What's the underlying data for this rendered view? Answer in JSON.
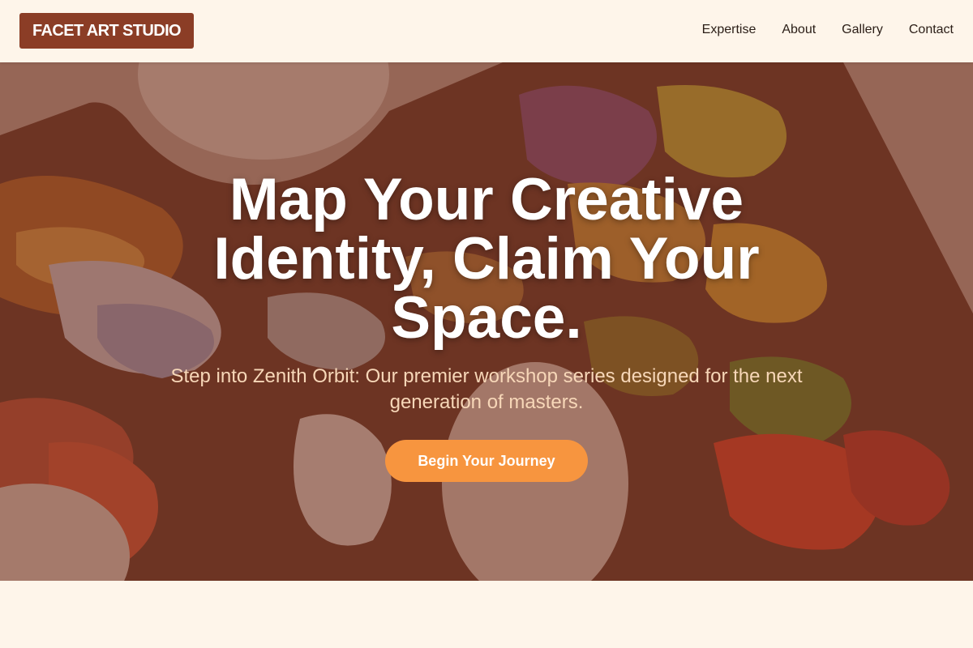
{
  "header": {
    "logo": "FACET ART STUDIO",
    "nav": [
      "Expertise",
      "About",
      "Gallery",
      "Contact"
    ]
  },
  "hero": {
    "title": "Map Your Creative Identity, Claim Your Space.",
    "subtitle": "Step into Zenith Orbit: Our premier workshop series designed for the next generation of masters.",
    "cta_label": "Begin Your Journey"
  },
  "colors": {
    "logo_bg": "#8b3d26",
    "cta_bg": "#f7953f",
    "page_bg": "#fef5ea",
    "overlay": "#70301e"
  }
}
